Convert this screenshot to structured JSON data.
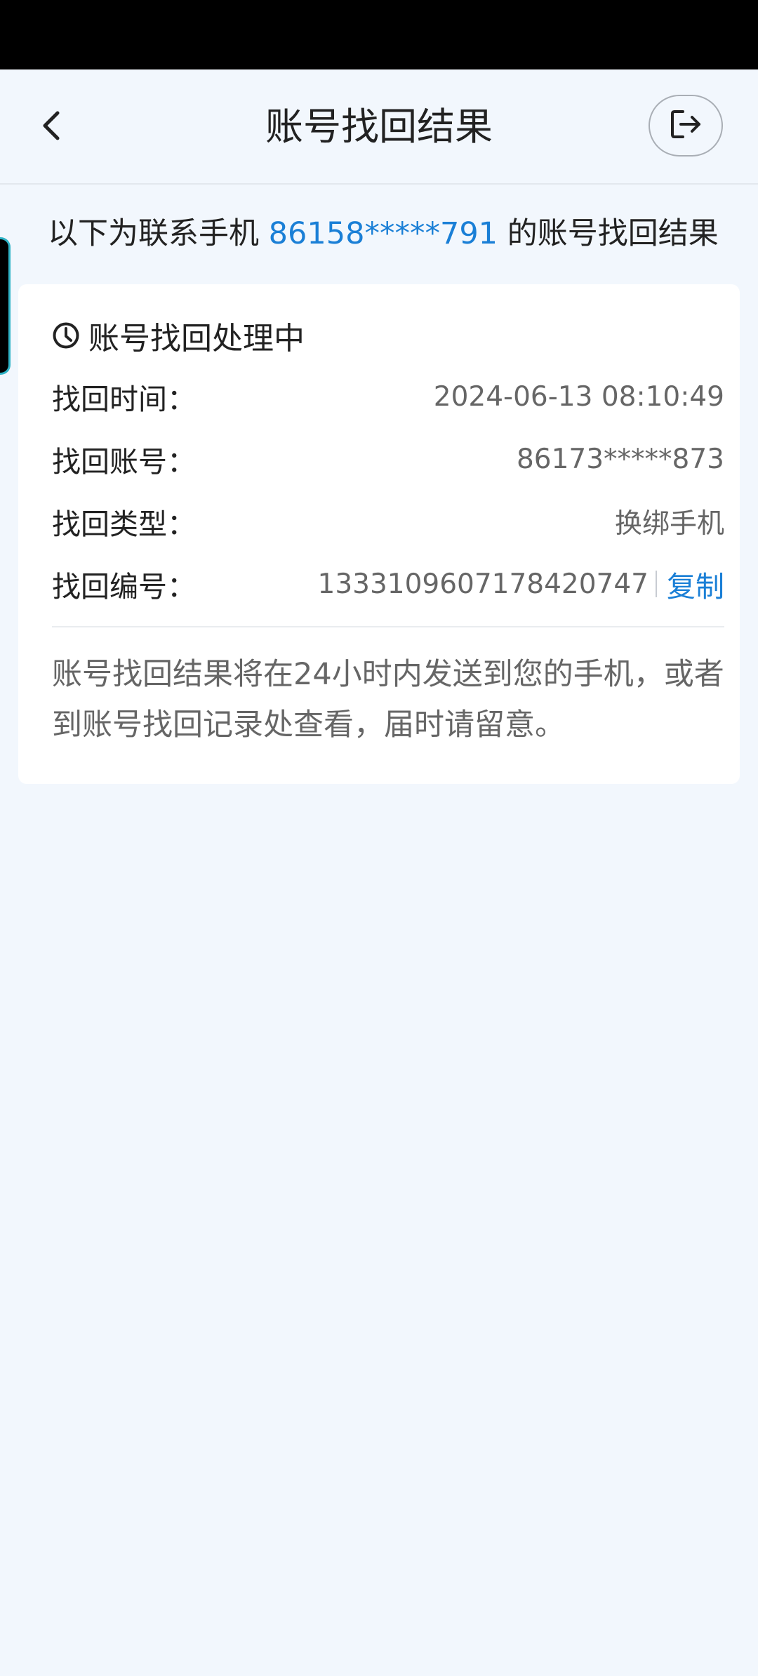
{
  "header": {
    "title": "账号找回结果",
    "back_icon": "chevron-left-icon",
    "exit_icon": "exit-icon"
  },
  "intro": {
    "prefix": "以下为联系手机 ",
    "phone": "86158*****791",
    "suffix": " 的账号找回结果"
  },
  "card": {
    "status_icon": "clock-icon",
    "status": "账号找回处理中",
    "rows": [
      {
        "label": "找回时间：",
        "value": "2024-06-13 08:10:49"
      },
      {
        "label": "找回账号：",
        "value": "86173*****873"
      },
      {
        "label": "找回类型：",
        "value": "换绑手机"
      },
      {
        "label": "找回编号：",
        "value": "1333109607178420747"
      }
    ],
    "copy_label": "复制",
    "note": "账号找回结果将在24小时内发送到您的手机，或者到账号找回记录处查看，届时请留意。"
  },
  "colors": {
    "accent": "#1a7fd6",
    "background": "#f2f7fd",
    "card": "#ffffff",
    "status_bar": "#000000"
  }
}
